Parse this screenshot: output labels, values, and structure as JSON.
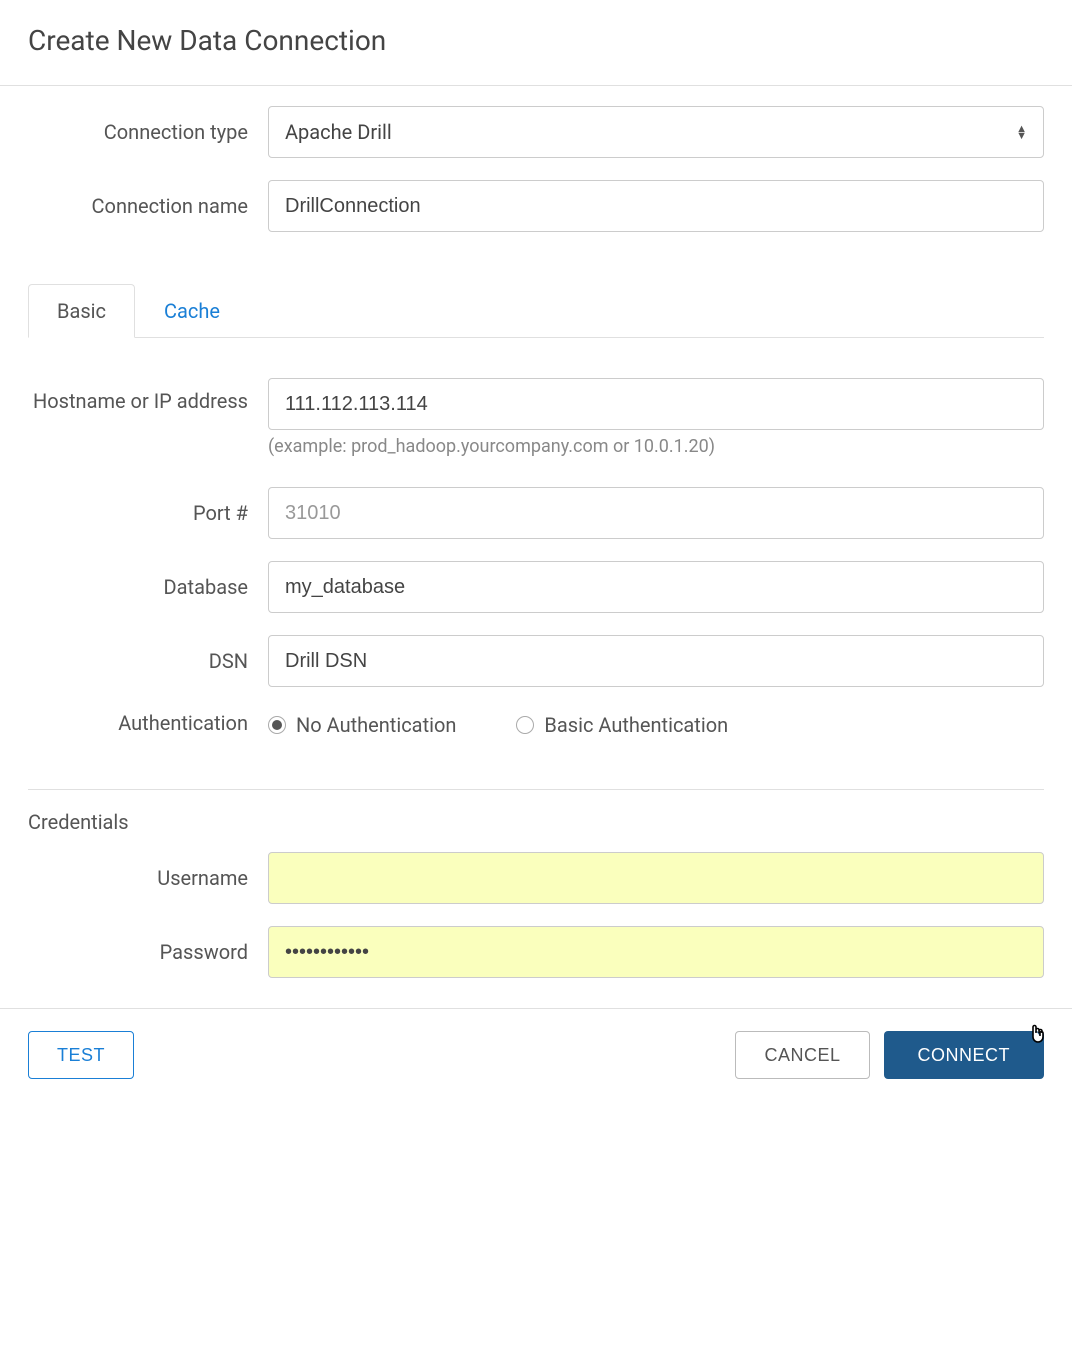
{
  "title": "Create New Data Connection",
  "connection_type": {
    "label": "Connection type",
    "value": "Apache Drill"
  },
  "connection_name": {
    "label": "Connection name",
    "value": "DrillConnection"
  },
  "tabs": {
    "basic": "Basic",
    "cache": "Cache"
  },
  "hostname": {
    "label": "Hostname or IP address",
    "value": "111.112.113.114",
    "hint": "(example: prod_hadoop.yourcompany.com or 10.0.1.20)"
  },
  "port": {
    "label": "Port #",
    "placeholder": "31010",
    "value": ""
  },
  "database": {
    "label": "Database",
    "value": "my_database"
  },
  "dsn": {
    "label": "DSN",
    "value": "Drill DSN"
  },
  "authentication": {
    "label": "Authentication",
    "options": {
      "none": "No Authentication",
      "basic": "Basic Authentication"
    },
    "selected": "none"
  },
  "credentials": {
    "heading": "Credentials",
    "username": {
      "label": "Username",
      "value": ""
    },
    "password": {
      "label": "Password",
      "value": "••••••••••••"
    }
  },
  "footer": {
    "test": "TEST",
    "cancel": "CANCEL",
    "connect": "CONNECT"
  }
}
